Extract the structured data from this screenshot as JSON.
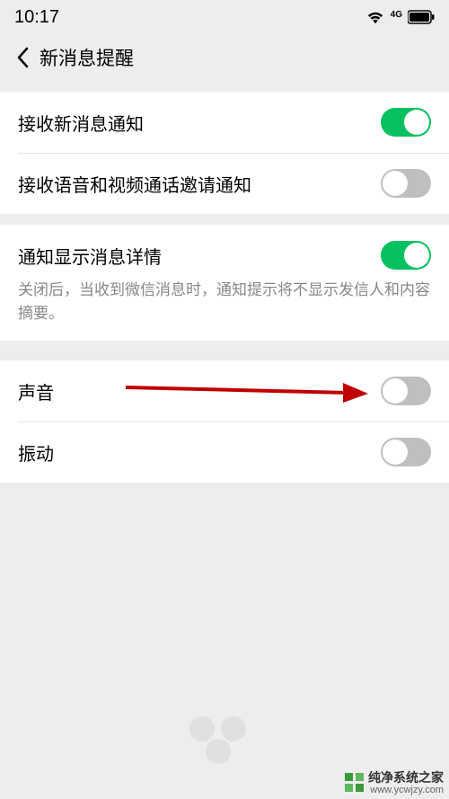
{
  "status": {
    "time": "10:17",
    "signal_type": "4G"
  },
  "header": {
    "title": "新消息提醒"
  },
  "rows": {
    "receive_new": {
      "label": "接收新消息通知",
      "on": true
    },
    "receive_call": {
      "label": "接收语音和视频通话邀请通知",
      "on": false
    },
    "show_detail": {
      "label": "通知显示消息详情",
      "on": true
    },
    "show_detail_desc": "关闭后，当收到微信消息时，通知提示将不显示发信人和内容摘要。",
    "sound": {
      "label": "声音",
      "on": false
    },
    "vibrate": {
      "label": "振动",
      "on": false
    }
  },
  "watermark": {
    "brand": "纯净系统之家",
    "url": "www.ycwjzy.com"
  }
}
